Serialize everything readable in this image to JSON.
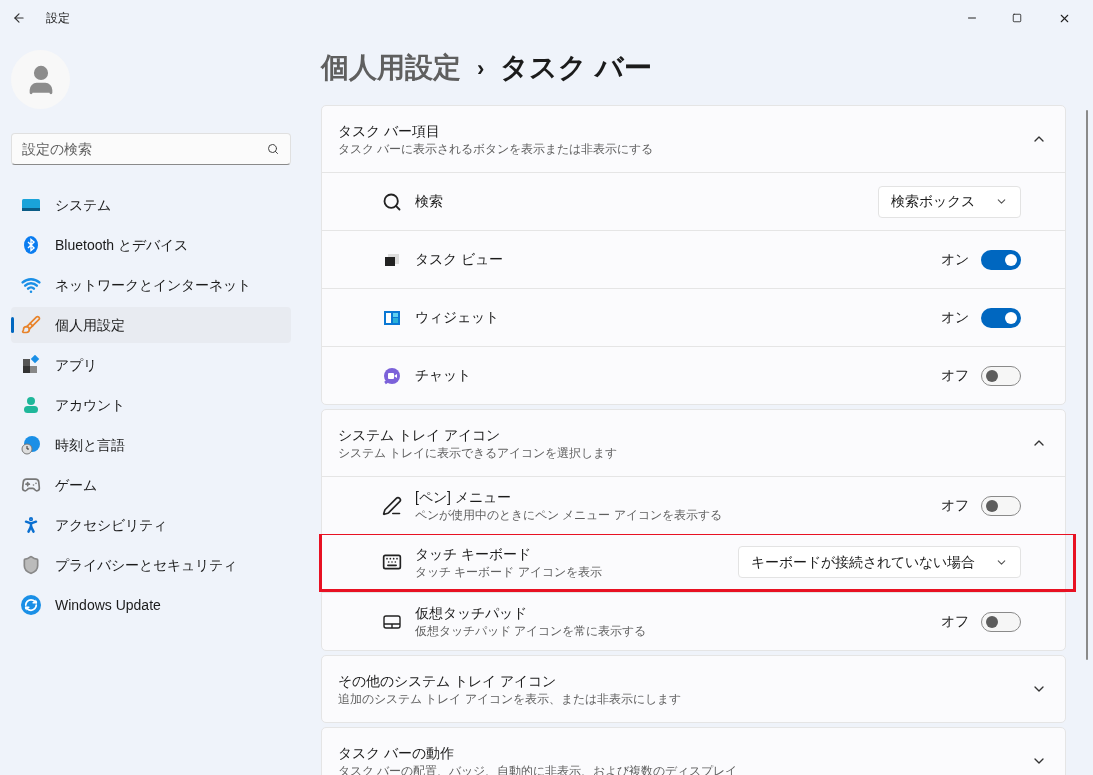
{
  "window": {
    "title": "設定"
  },
  "sidebar": {
    "search": {
      "placeholder": "設定の検索"
    },
    "items": [
      {
        "label": "システム",
        "selected": false
      },
      {
        "label": "Bluetooth とデバイス",
        "selected": false
      },
      {
        "label": "ネットワークとインターネット",
        "selected": false
      },
      {
        "label": "個人用設定",
        "selected": true
      },
      {
        "label": "アプリ",
        "selected": false
      },
      {
        "label": "アカウント",
        "selected": false
      },
      {
        "label": "時刻と言語",
        "selected": false
      },
      {
        "label": "ゲーム",
        "selected": false
      },
      {
        "label": "アクセシビリティ",
        "selected": false
      },
      {
        "label": "プライバシーとセキュリティ",
        "selected": false
      },
      {
        "label": "Windows Update",
        "selected": false
      }
    ]
  },
  "breadcrumb": {
    "parent": "個人用設定",
    "separator": "›",
    "current": "タスク バー"
  },
  "sections": [
    {
      "title": "タスク バー項目",
      "description": "タスク バーに表示されるボタンを表示または非表示にする",
      "expanded": true,
      "items": [
        {
          "kind": "dropdown",
          "label": "検索",
          "value": "検索ボックス",
          "highlighted": false
        },
        {
          "kind": "toggle",
          "label": "タスク ビュー",
          "state_text": "オン",
          "on": true,
          "highlighted": false
        },
        {
          "kind": "toggle",
          "label": "ウィジェット",
          "state_text": "オン",
          "on": true,
          "highlighted": false
        },
        {
          "kind": "toggle",
          "label": "チャット",
          "state_text": "オフ",
          "on": false,
          "highlighted": false
        }
      ]
    },
    {
      "title": "システム トレイ アイコン",
      "description": "システム トレイに表示できるアイコンを選択します",
      "expanded": true,
      "items": [
        {
          "kind": "toggle",
          "label": "[ペン] メニュー",
          "description": "ペンが使用中のときにペン メニュー アイコンを表示する",
          "state_text": "オフ",
          "on": false,
          "highlighted": false
        },
        {
          "kind": "dropdown",
          "label": "タッチ キーボード",
          "description": "タッチ キーボード アイコンを表示",
          "value": "キーボードが接続されていない場合",
          "highlighted": true
        },
        {
          "kind": "toggle",
          "label": "仮想タッチパッド",
          "description": "仮想タッチパッド アイコンを常に表示する",
          "state_text": "オフ",
          "on": false,
          "highlighted": false
        }
      ]
    },
    {
      "title": "その他のシステム トレイ アイコン",
      "description": "追加のシステム トレイ アイコンを表示、または非表示にします",
      "expanded": false
    },
    {
      "title": "タスク バーの動作",
      "description": "タスク バーの配置、バッジ、自動的に非表示、および複数のディスプレイ",
      "expanded": false
    }
  ]
}
